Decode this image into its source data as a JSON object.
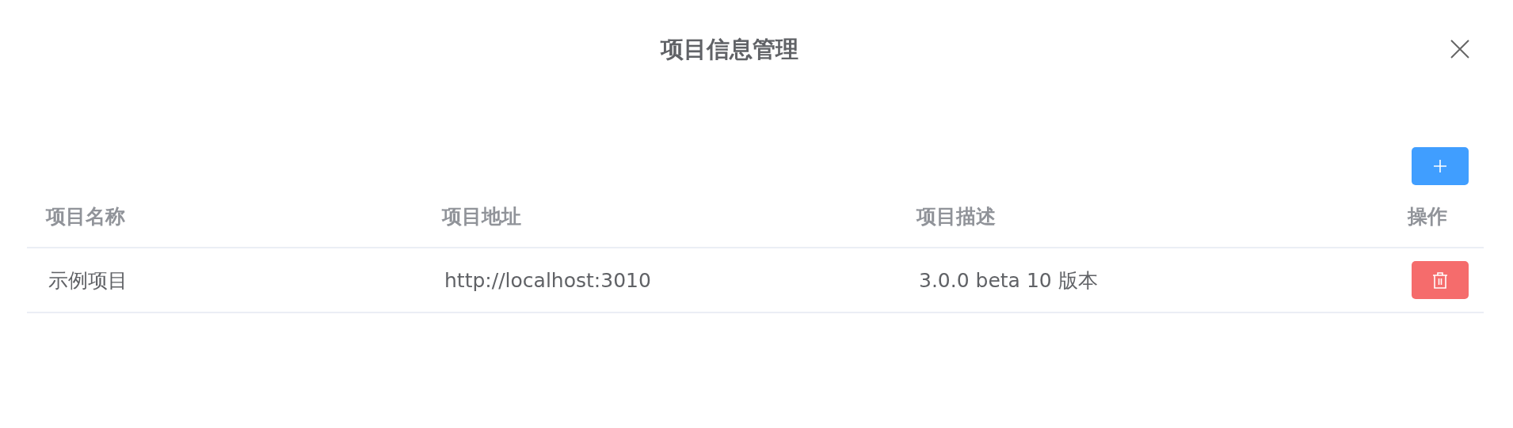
{
  "dialog": {
    "title": "项目信息管理"
  },
  "table": {
    "columns": [
      "项目名称",
      "项目地址",
      "项目描述",
      "操作"
    ],
    "rows": [
      {
        "cells": [
          "示例项目",
          "http://localhost:3010",
          "3.0.0 beta 10 版本"
        ]
      }
    ]
  }
}
